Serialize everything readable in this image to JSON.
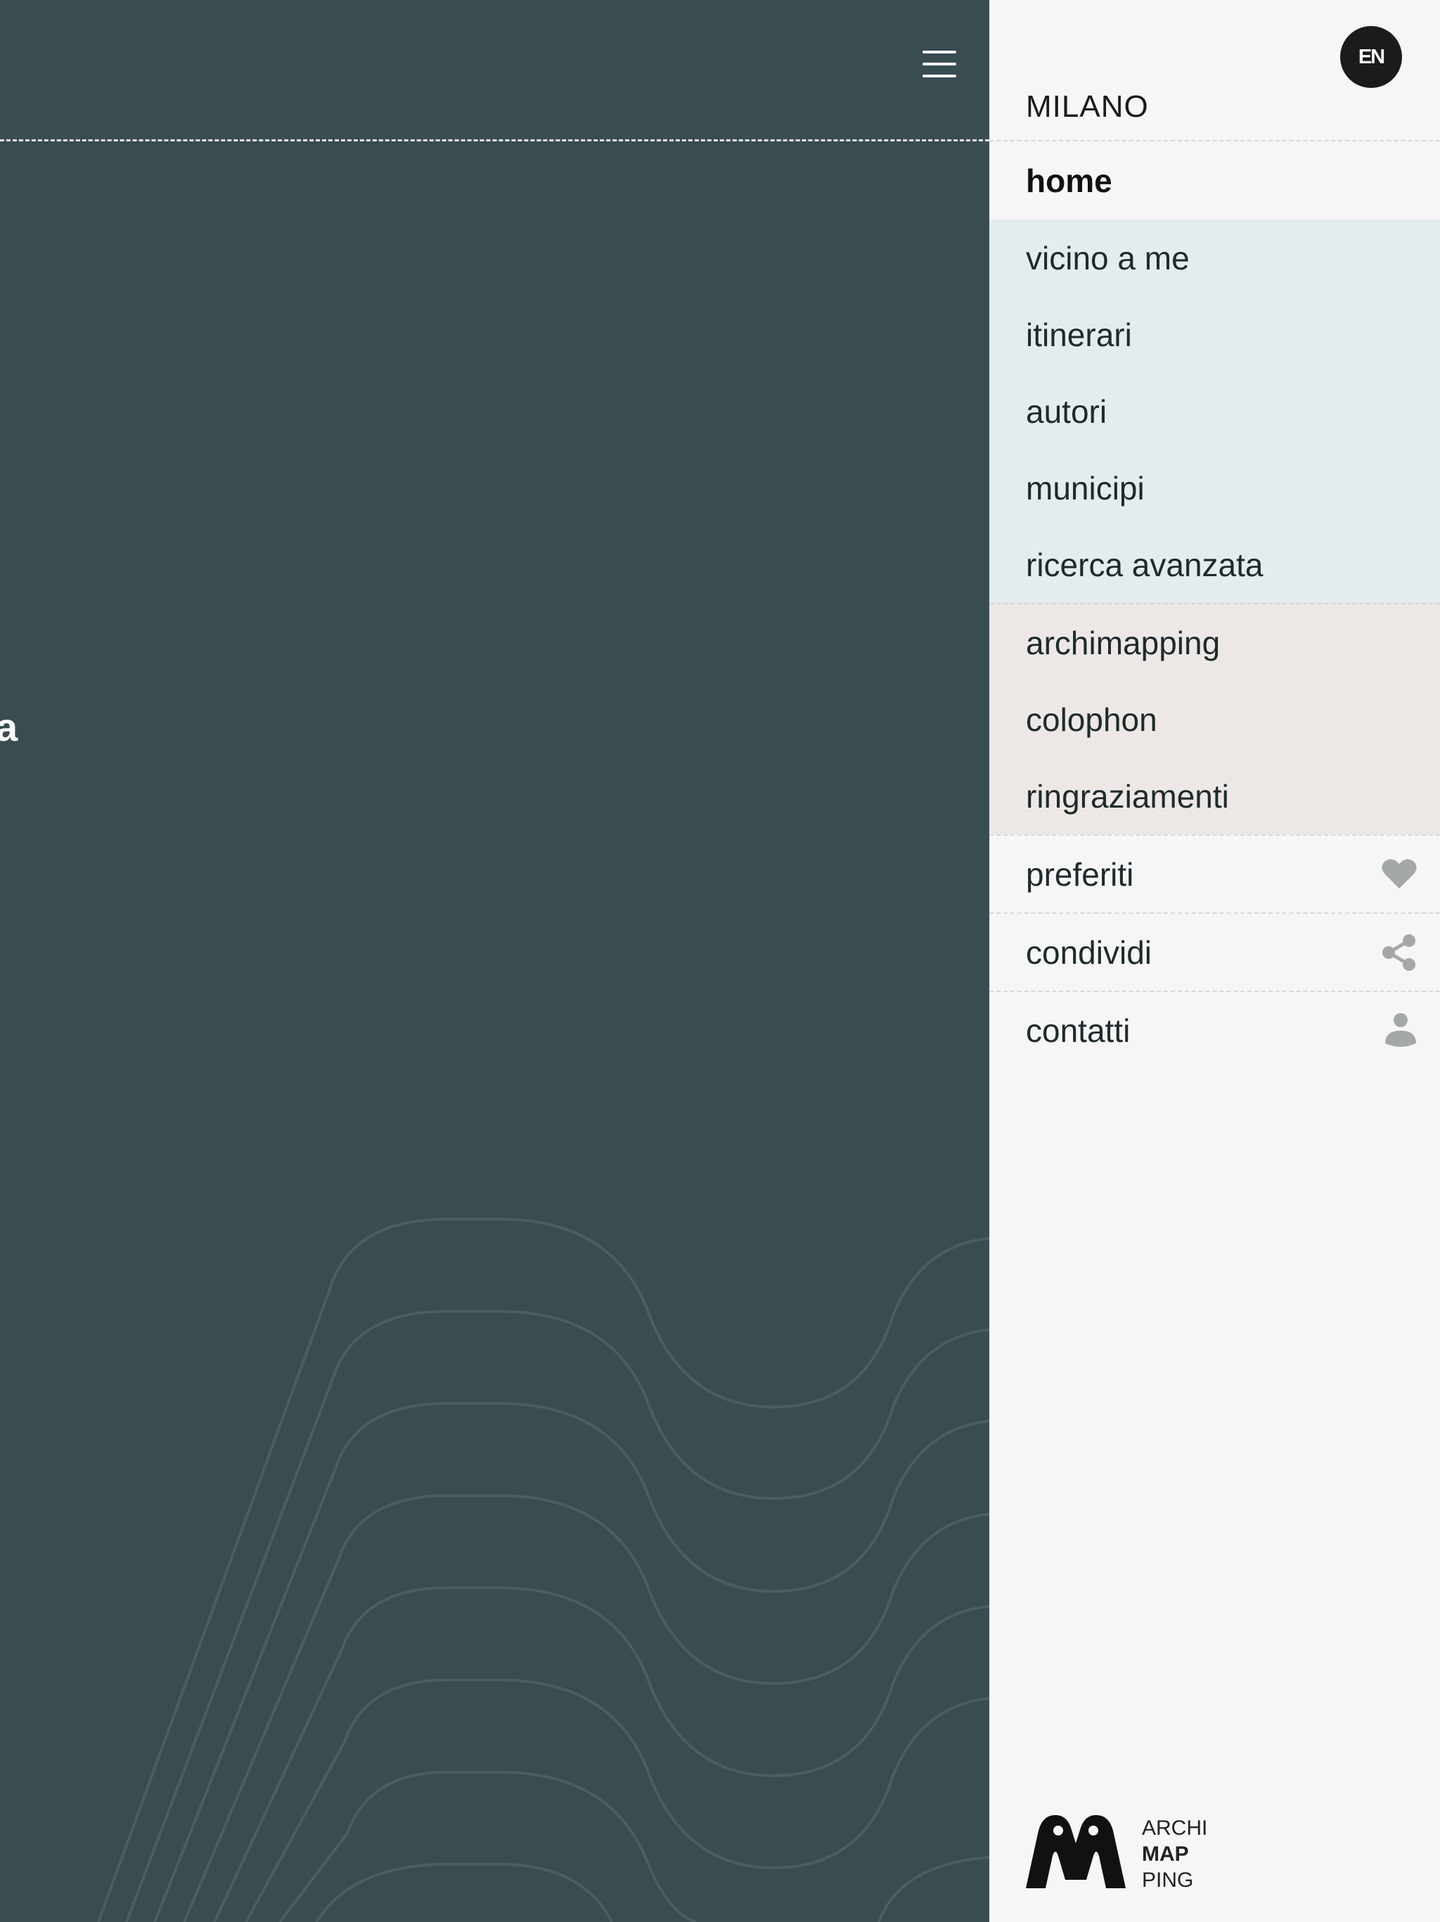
{
  "header": {
    "partial_title": "a",
    "menu_icon": "hamburger-icon"
  },
  "drawer": {
    "language_button": "EN",
    "city": "MILANO",
    "items": {
      "home": "home",
      "vicino": "vicino a me",
      "itinerari": "itinerari",
      "autori": "autori",
      "municipi": "municipi",
      "ricerca": "ricerca avanzata",
      "archimapping": "archimapping",
      "colophon": "colophon",
      "ringraziamenti": "ringraziamenti",
      "preferiti": "preferiti",
      "condividi": "condividi",
      "contatti": "contatti"
    },
    "icons": {
      "preferiti": "heart-icon",
      "condividi": "share-icon",
      "contatti": "user-icon"
    },
    "logo": {
      "line1": "ARCHI",
      "line2": "MAP",
      "line3": "PING"
    }
  },
  "colors": {
    "background": "#394c50",
    "drawer": "#f6f6f6",
    "group_blue": "#e4ecee",
    "group_beige": "#ede8e5",
    "icon_gray": "#a5a8a9"
  }
}
